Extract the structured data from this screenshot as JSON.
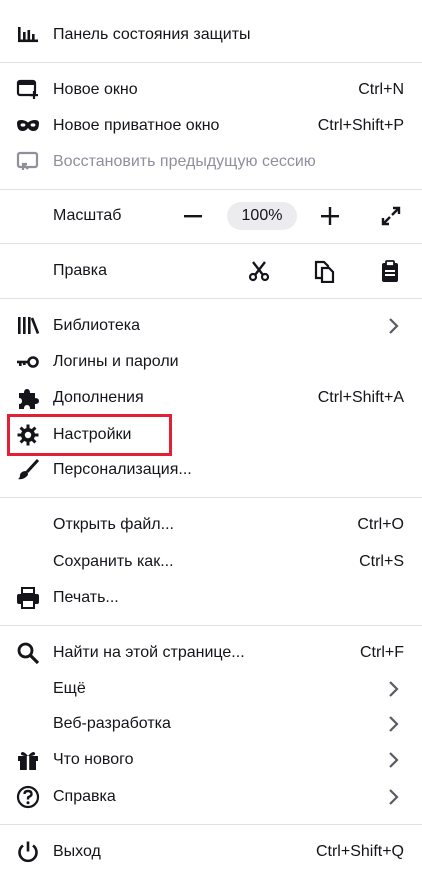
{
  "menu": {
    "protection_dashboard": "Панель состояния защиты",
    "new_window": {
      "label": "Новое окно",
      "shortcut": "Ctrl+N"
    },
    "new_private_window": {
      "label": "Новое приватное окно",
      "shortcut": "Ctrl+Shift+P"
    },
    "restore_session": "Восстановить предыдущую сессию",
    "zoom": {
      "label": "Масштаб",
      "minus": "−",
      "value": "100%",
      "plus": "+"
    },
    "edit": {
      "label": "Правка"
    },
    "library": "Библиотека",
    "logins": "Логины и пароли",
    "addons": {
      "label": "Дополнения",
      "shortcut": "Ctrl+Shift+A"
    },
    "settings": "Настройки",
    "customize": "Персонализация...",
    "open_file": {
      "label": "Открыть файл...",
      "shortcut": "Ctrl+O"
    },
    "save_as": {
      "label": "Сохранить как...",
      "shortcut": "Ctrl+S"
    },
    "print": "Печать...",
    "find": {
      "label": "Найти на этой странице...",
      "shortcut": "Ctrl+F"
    },
    "more": "Ещё",
    "web_dev": "Веб-разработка",
    "whats_new": "Что нового",
    "help": "Справка",
    "quit": {
      "label": "Выход",
      "shortcut": "Ctrl+Shift+Q"
    }
  },
  "colors": {
    "highlight": "#e22035",
    "text": "#15141a",
    "disabled": "#8f8f9d"
  }
}
